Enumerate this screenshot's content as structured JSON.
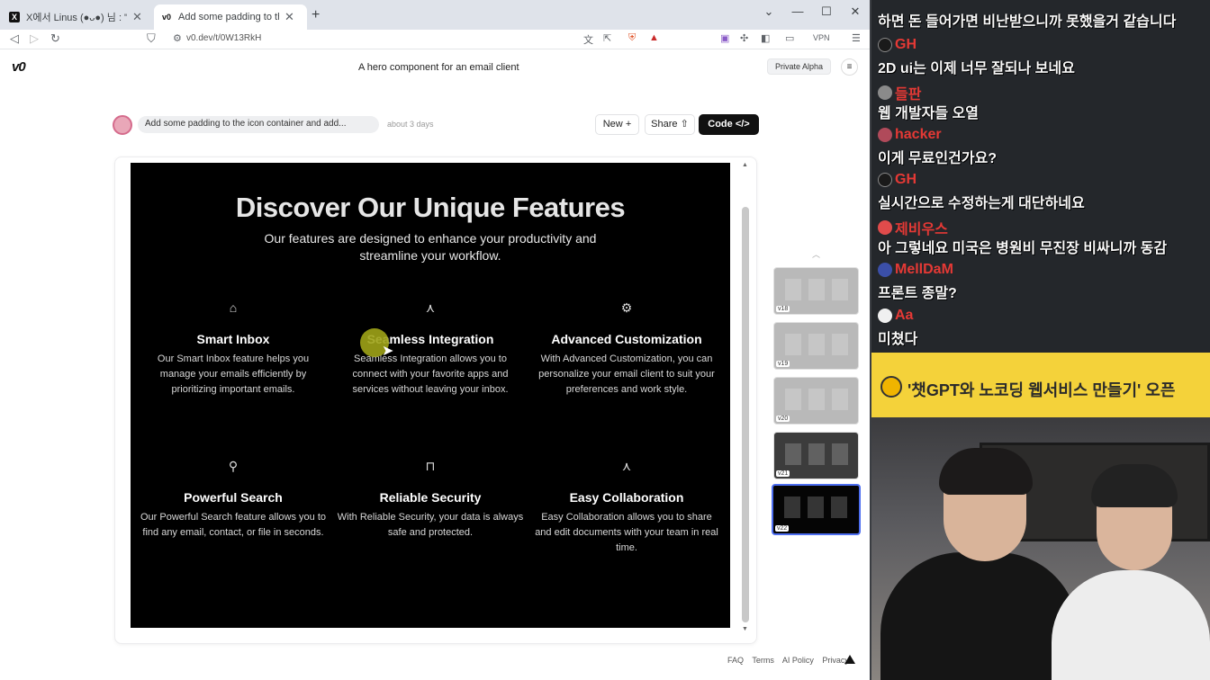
{
  "tabs": [
    {
      "title": "X에서 Linus (●ᴗ●) 님 : \"Get Front-e",
      "favicon": "x-logo-icon"
    },
    {
      "title": "Add some padding to the icon c",
      "favicon": "v0-logo-icon"
    }
  ],
  "address_bar": {
    "url": "v0.dev/t/0W13RkH",
    "vpn_label": "VPN"
  },
  "v0": {
    "logo": "v0",
    "page_title": "A hero component for an email client",
    "badge": "Private Alpha",
    "prompt_text": "Add some padding to the icon container and add...",
    "time_ago": "about 3 days",
    "new_label": "New",
    "share_label": "Share",
    "code_label": "Code"
  },
  "preview": {
    "title": "Discover Our Unique Features",
    "subtitle": "Our features are designed to enhance your productivity and streamline your workflow.",
    "features": [
      {
        "icon": "inbox-icon",
        "title": "Smart Inbox",
        "desc": "Our Smart Inbox feature helps you manage your emails efficiently by prioritizing important emails."
      },
      {
        "icon": "merge-icon",
        "title": "Seamless Integration",
        "desc": "Seamless Integration allows you to connect with your favorite apps and services without leaving your inbox."
      },
      {
        "icon": "gear-icon",
        "title": "Advanced Customization",
        "desc": "With Advanced Customization, you can personalize your email client to suit your preferences and work style."
      },
      {
        "icon": "search-icon",
        "title": "Powerful Search",
        "desc": "Our Powerful Search feature allows you to find any email, contact, or file in seconds."
      },
      {
        "icon": "lock-icon",
        "title": "Reliable Security",
        "desc": "With Reliable Security, your data is always safe and protected."
      },
      {
        "icon": "merge-icon",
        "title": "Easy Collaboration",
        "desc": "Easy Collaboration allows you to share and edit documents with your team in real time."
      }
    ]
  },
  "versions": [
    "v18",
    "v19",
    "v20",
    "v21",
    "v22"
  ],
  "footer": {
    "faq": "FAQ",
    "terms": "Terms",
    "ai_policy": "AI Policy",
    "privacy": "Privacy"
  },
  "chat": [
    {
      "user": "",
      "msg": "하면 돈 들어가면 비난받으니까 못했을거 같습니다",
      "name_color": "#ffffff"
    },
    {
      "user": "GH",
      "msg": "2D ui는 이제 너무 잘되나 보네요",
      "name_color": "#e53935"
    },
    {
      "user": "들판",
      "msg": "웹 개발자들 오열",
      "name_color": "#e53935"
    },
    {
      "user": "hacker",
      "msg": "이게 무료인건가요?",
      "name_color": "#e53935"
    },
    {
      "user": "GH",
      "msg": "실시간으로 수정하는게 대단하네요",
      "name_color": "#e53935"
    },
    {
      "user": "제비우스",
      "msg": "아 그렇네요 미국은 병원비 무진장 비싸니까 동감",
      "name_color": "#e53935"
    },
    {
      "user": "MellDaM",
      "msg": "프론트 종말?",
      "name_color": "#e53935"
    },
    {
      "user": "Aa",
      "msg": "미쳤다",
      "name_color": "#e53935"
    }
  ],
  "banner": {
    "text": "'챗GPT와 노코딩 웹서비스 만들기' 오픈"
  }
}
